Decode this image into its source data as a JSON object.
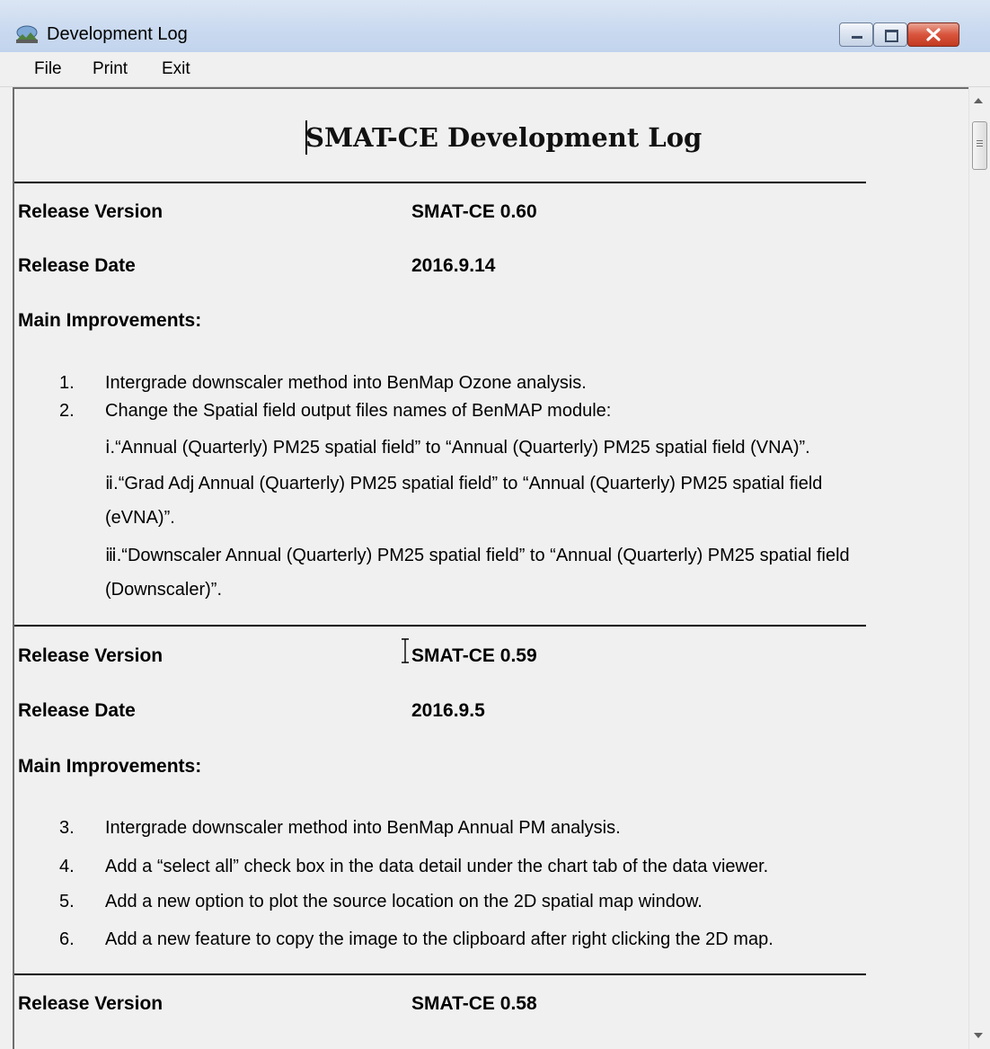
{
  "window": {
    "title": "Development Log"
  },
  "menu": {
    "file": "File",
    "print": "Print",
    "exit": "Exit"
  },
  "doc": {
    "title": "SMAT-CE Development Log",
    "releases": [
      {
        "version_label": "Release Version",
        "version": "SMAT-CE 0.60",
        "date_label": "Release Date",
        "date": "2016.9.14",
        "improvements_label": "Main Improvements:",
        "items": [
          {
            "num": "1.",
            "text": "Intergrade downscaler method into BenMap Ozone analysis."
          },
          {
            "num": "2.",
            "text": "Change the Spatial field output files names of BenMAP module:"
          }
        ],
        "subitems": [
          "ⅰ.“Annual (Quarterly) PM25 spatial field” to “Annual (Quarterly) PM25 spatial field (VNA)”.",
          "ⅱ.“Grad Adj Annual (Quarterly) PM25 spatial field” to “Annual (Quarterly) PM25 spatial field",
          "(eVNA)”.",
          "ⅲ.“Downscaler Annual (Quarterly) PM25 spatial field” to “Annual (Quarterly) PM25 spatial field",
          "(Downscaler)”."
        ]
      },
      {
        "version_label": "Release Version",
        "version": "SMAT-CE 0.59",
        "date_label": "Release Date",
        "date": "2016.9.5",
        "improvements_label": "Main Improvements:",
        "items": [
          {
            "num": "3.",
            "text": "Intergrade downscaler method into BenMap Annual PM analysis."
          },
          {
            "num": "4.",
            "text": "Add a “select all” check box in the data detail under the chart tab of the data viewer."
          },
          {
            "num": "5.",
            "text": "Add a new option to plot the source location on the 2D spatial map window."
          },
          {
            "num": "6.",
            "text": "Add a new feature to copy the image to the clipboard after right clicking the 2D map."
          }
        ]
      },
      {
        "version_label": "Release Version",
        "version": "SMAT-CE 0.58"
      }
    ]
  }
}
